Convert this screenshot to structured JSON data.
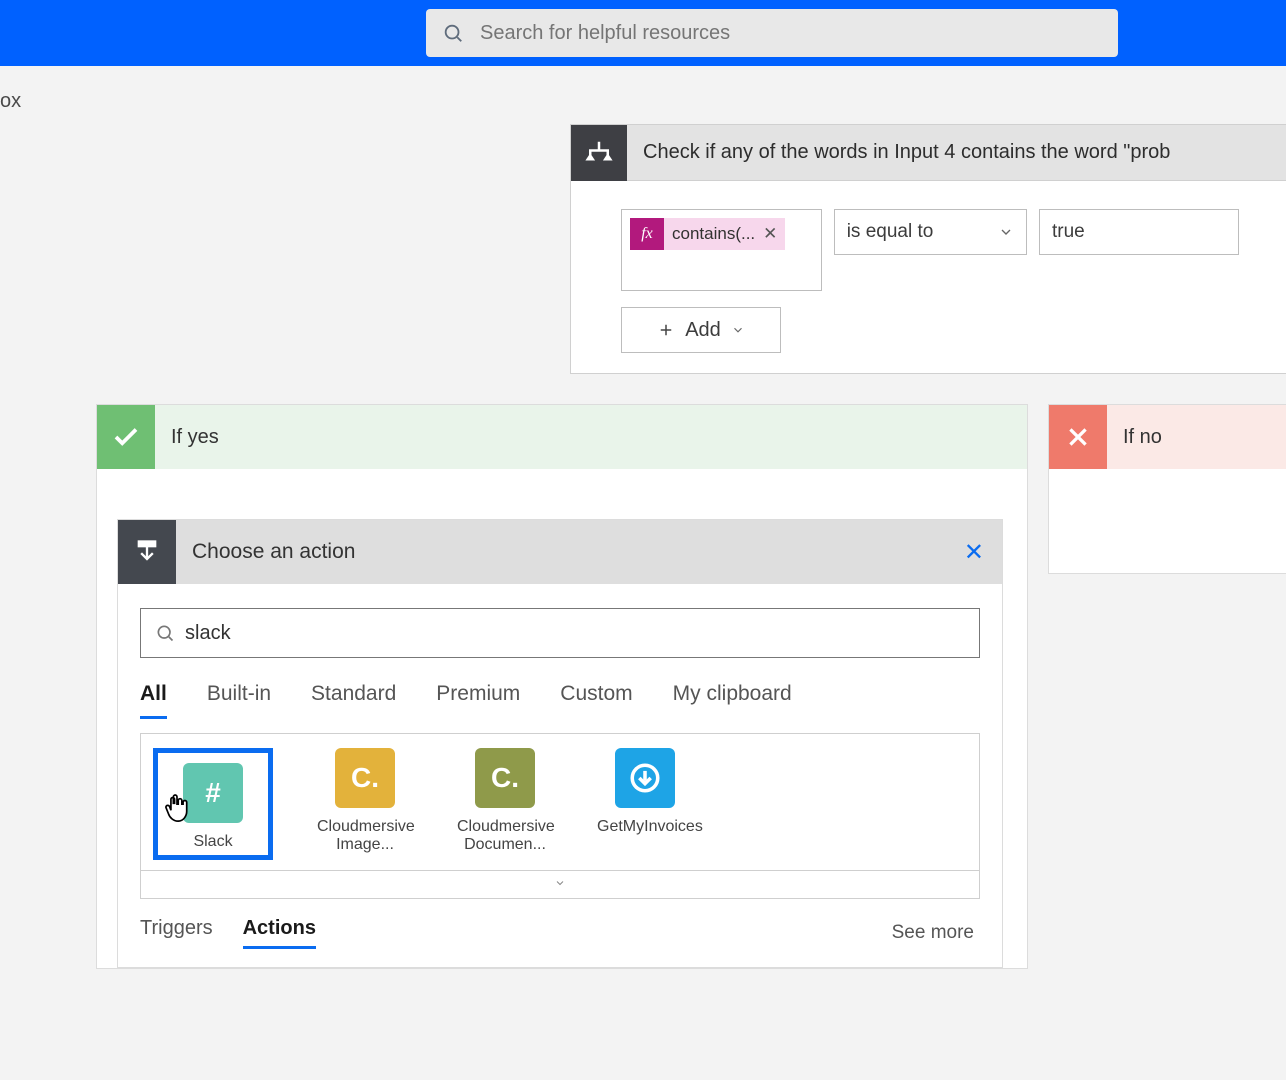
{
  "topbar": {
    "search_placeholder": "Search for helpful resources"
  },
  "breadcrumb": "ox",
  "condition": {
    "title": "Check if any of the words in Input 4 contains the word \"prob",
    "expression_label": "contains(...",
    "operator": "is equal to",
    "value": "true",
    "add_label": "Add"
  },
  "branches": {
    "yes_label": "If yes",
    "no_label": "If no"
  },
  "action_picker": {
    "title": "Choose an action",
    "search_value": "slack",
    "tabs": [
      "All",
      "Built-in",
      "Standard",
      "Premium",
      "Custom",
      "My clipboard"
    ],
    "tabs_active_index": 0,
    "connectors": [
      {
        "name": "Slack"
      },
      {
        "name": "Cloudmersive Image..."
      },
      {
        "name": "Cloudmersive Documen..."
      },
      {
        "name": "GetMyInvoices"
      }
    ],
    "connector_selected_index": 0,
    "bottom_tabs": [
      "Triggers",
      "Actions"
    ],
    "bottom_active_index": 1,
    "see_more": "See more"
  }
}
